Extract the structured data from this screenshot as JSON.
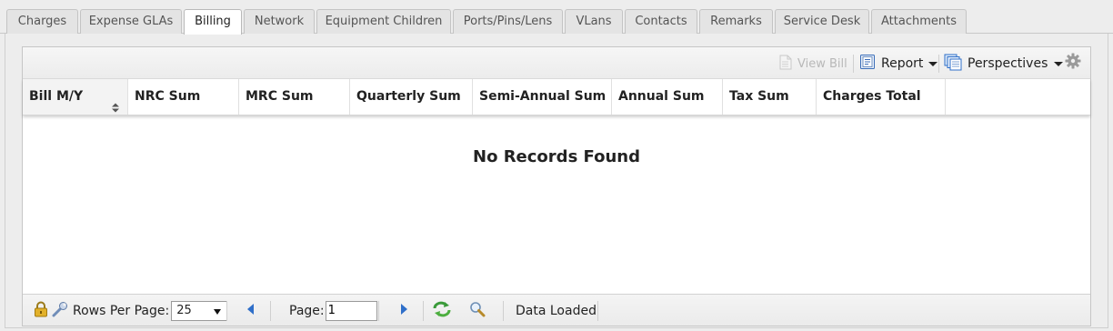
{
  "tabs": [
    {
      "label": "Charges",
      "active": false
    },
    {
      "label": "Expense GLAs",
      "active": false
    },
    {
      "label": "Billing",
      "active": true
    },
    {
      "label": "Network",
      "active": false
    },
    {
      "label": "Equipment Children",
      "active": false
    },
    {
      "label": "Ports/Pins/Lens",
      "active": false
    },
    {
      "label": "VLans",
      "active": false
    },
    {
      "label": "Contacts",
      "active": false
    },
    {
      "label": "Remarks",
      "active": false
    },
    {
      "label": "Service Desk",
      "active": false
    },
    {
      "label": "Attachments",
      "active": false
    }
  ],
  "toolbar": {
    "view_bill": "View Bill",
    "report": "Report",
    "perspectives": "Perspectives",
    "view_bill_icon": "document-icon",
    "report_icon": "report-icon",
    "perspectives_icon": "perspectives-icon",
    "settings_icon": "gear-icon"
  },
  "columns": [
    "Bill M/Y",
    "NRC Sum",
    "MRC Sum",
    "Quarterly Sum",
    "Semi-Annual Sum",
    "Annual Sum",
    "Tax Sum",
    "Charges Total"
  ],
  "empty_message": "No Records Found",
  "footer": {
    "rows_per_page_label": "Rows Per Page:",
    "rows_per_page_value": "25",
    "page_label": "Page:",
    "page_value": "1",
    "status": "Data Loaded"
  },
  "colors": {
    "accent_blue": "#2f6fc9",
    "refresh_green": "#3a9a3a",
    "lock_gold": "#d4a017"
  }
}
